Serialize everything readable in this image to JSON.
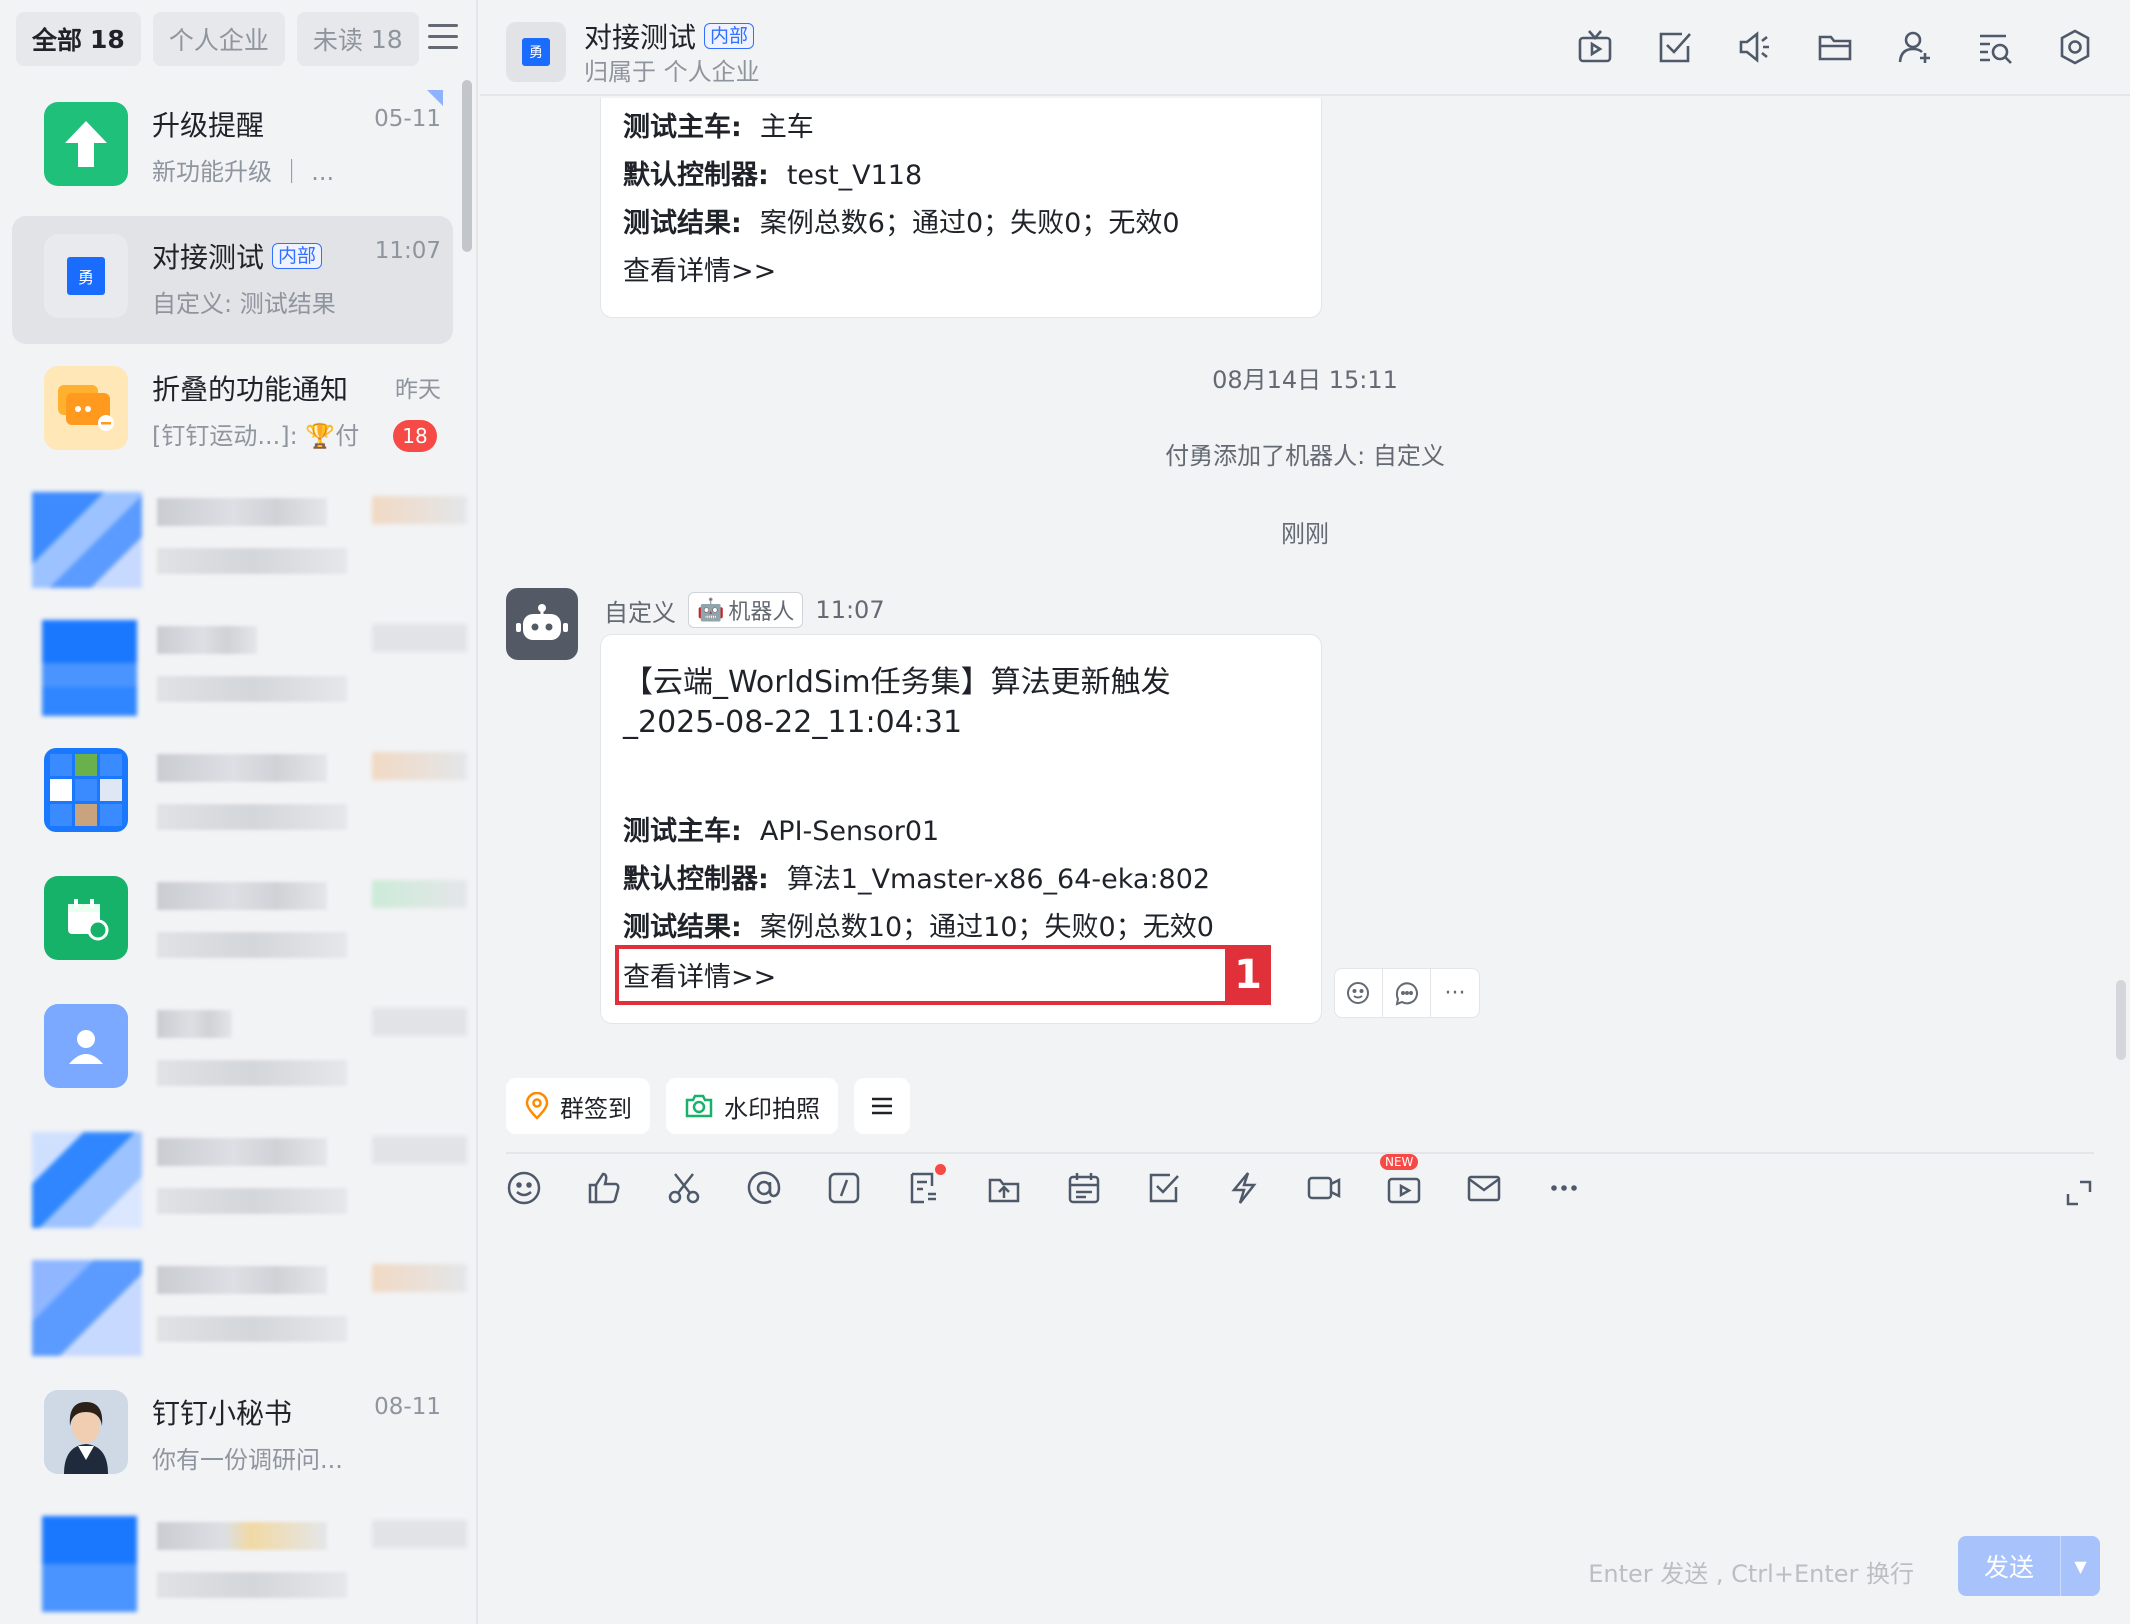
{
  "sidebar": {
    "tabs": [
      {
        "label": "全部",
        "count": "18"
      },
      {
        "label": "个人企业",
        "count": ""
      },
      {
        "label": "未读",
        "count": "18"
      }
    ],
    "conversations": [
      {
        "name": "升级提醒",
        "tag": "",
        "time": "05-11",
        "preview": "新功能升级 ｜ ...",
        "unread": "",
        "icon": "arrow-up-icon",
        "color": "#1fc07a"
      },
      {
        "name": "对接测试",
        "tag": "内部",
        "time": "11:07",
        "preview": "自定义: 测试结果",
        "unread": "",
        "icon": "group-icon",
        "color": "#1a6cff"
      },
      {
        "name": "折叠的功能通知",
        "tag": "",
        "time": "昨天",
        "preview": "[钉钉运动...]: 🏆付",
        "unread": "18",
        "icon": "folded-chat-icon",
        "color": "#ffb02e"
      },
      {
        "name": "钉钉小秘书",
        "tag": "",
        "time": "08-11",
        "preview": "你有一份调研问...",
        "unread": "",
        "icon": "assistant-avatar",
        "color": "#e9c9b3"
      }
    ]
  },
  "header": {
    "title": "对接测试",
    "tag": "内部",
    "subtitle": "归属于 个人企业",
    "avatar_char": "勇",
    "icons": [
      "live-icon",
      "todo-icon",
      "announce-icon",
      "folder-icon",
      "add-member-icon",
      "search-history-icon",
      "settings-icon"
    ]
  },
  "messages": {
    "card1": {
      "rows": [
        {
          "label": "测试主车:",
          "value": "主车"
        },
        {
          "label": "默认控制器:",
          "value": "test_V118"
        },
        {
          "label": "测试结果:",
          "value": "案例总数6；通过0；失败0；无效0"
        }
      ],
      "link": "查看详情>>"
    },
    "time1": "08月14日 15:11",
    "system": "付勇添加了机器人: 自定义",
    "time2": "刚刚",
    "sender": "自定义",
    "robot_label": "机器人",
    "sender_time": "11:07",
    "card2": {
      "title1": "【云端_WorldSim任务集】算法更新触发",
      "title2": "_2025-08-22_11:04:31",
      "rows": [
        {
          "label": "测试主车:",
          "value": "API-Sensor01"
        },
        {
          "label": "默认控制器:",
          "value": "算法1_Vmaster-x86_64-eka:802"
        },
        {
          "label": "测试结果:",
          "value": "案例总数10；通过10；失败0；无效0"
        }
      ],
      "link": "查看详情>>",
      "annotation": "1"
    },
    "more_actions": "···"
  },
  "quick_actions": [
    {
      "label": "群签到",
      "icon": "location-pin-icon"
    },
    {
      "label": "水印拍照",
      "icon": "camera-icon"
    }
  ],
  "toolbar": {
    "icons": [
      "emoji-icon",
      "thumbs-up-icon",
      "scissors-icon",
      "at-icon",
      "slash-command-icon",
      "doc-icon",
      "upload-icon",
      "calendar-icon",
      "task-icon",
      "lightning-icon",
      "video-icon",
      "live-icon",
      "mail-icon",
      "more-icon"
    ],
    "new_badge": "NEW"
  },
  "composer": {
    "hint": "Enter 发送 , Ctrl+Enter 换行",
    "send_label": "发送"
  }
}
